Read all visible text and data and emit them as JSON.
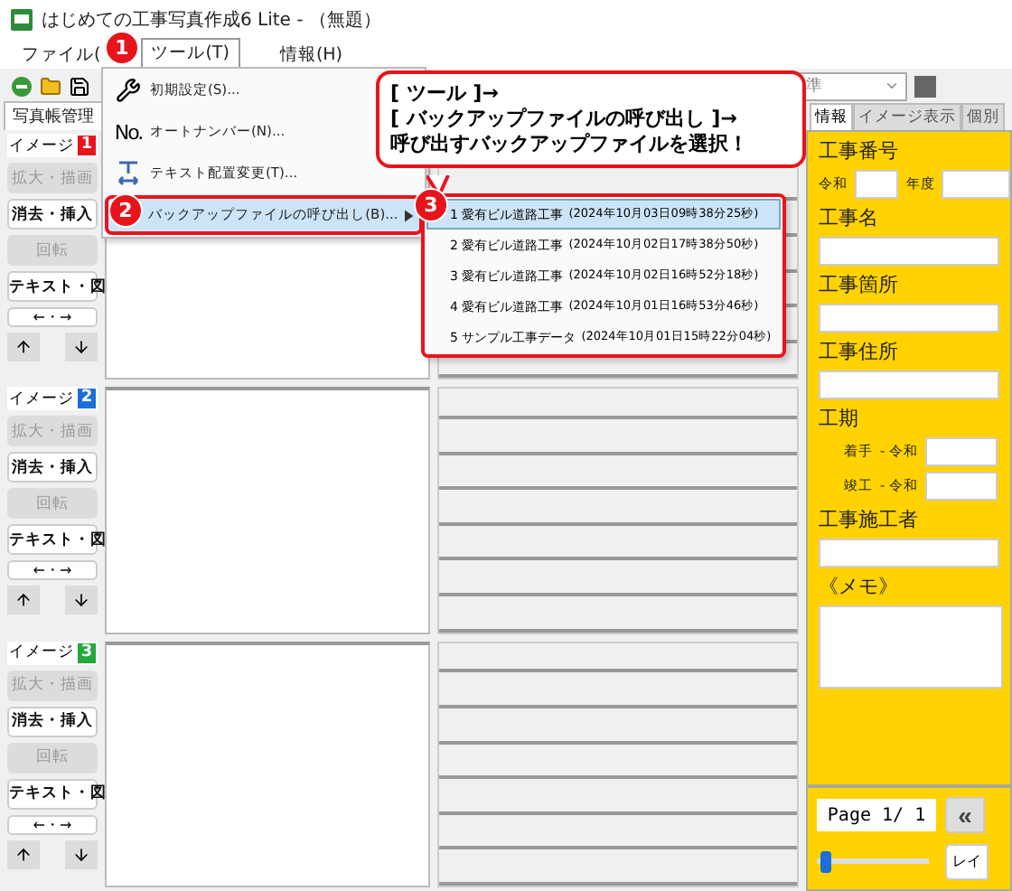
{
  "window": {
    "title": "はじめての工事写真作成6 Lite - （無題）"
  },
  "menu_bar": [
    {
      "label": "ファイル(",
      "selected": false
    },
    {
      "label": "ツール(T)",
      "selected": true
    },
    {
      "label": "情報(H)",
      "selected": false
    }
  ],
  "toolbar": {
    "style_select": "準"
  },
  "left_tabs": [
    {
      "label": "写真帳管理",
      "selected": true
    }
  ],
  "images": [
    {
      "label": "イメージ",
      "number": "1",
      "color": "#e8141c",
      "buttons": [
        {
          "label": "拡大・描画",
          "disabled": true
        },
        {
          "label": "消去・挿入",
          "disabled": false
        },
        {
          "label": "回転",
          "disabled": true
        },
        {
          "label": "テキスト・図",
          "disabled": false
        }
      ],
      "lr": "←・→"
    },
    {
      "label": "イメージ",
      "number": "2",
      "color": "#1a6fd8",
      "buttons": [
        {
          "label": "拡大・描画",
          "disabled": true
        },
        {
          "label": "消去・挿入",
          "disabled": false
        },
        {
          "label": "回転",
          "disabled": true
        },
        {
          "label": "テキスト・図",
          "disabled": false
        }
      ],
      "lr": "←・→"
    },
    {
      "label": "イメージ",
      "number": "3",
      "color": "#22a83a",
      "buttons": [
        {
          "label": "拡大・描画",
          "disabled": true
        },
        {
          "label": "消去・挿入",
          "disabled": false
        },
        {
          "label": "回転",
          "disabled": true
        },
        {
          "label": "テキスト・図",
          "disabled": false
        }
      ],
      "lr": "←・→"
    }
  ],
  "right_tabs": [
    {
      "label": "情報",
      "selected": true
    },
    {
      "label": "イメージ表示",
      "selected": false
    },
    {
      "label": "個別",
      "selected": false
    }
  ],
  "info": {
    "number_label": "工事番号",
    "era": "令和",
    "year_suffix": "年度",
    "name_label": "工事名",
    "place_label": "工事箇所",
    "address_label": "工事住所",
    "period_label": "工期",
    "start_label": "着手",
    "end_label": "竣工",
    "start_era": "- 令和",
    "end_era": "- 令和",
    "builder_label": "工事施工者",
    "memo_label": "《メモ》"
  },
  "pager": {
    "page": "Page 1/ 1",
    "first": "«",
    "layout": "レイ",
    "level": 0.03
  },
  "tool_menu": [
    {
      "label": "初期設定(S)...",
      "selected": false,
      "submenu": false
    },
    {
      "icon_text": "No.",
      "label": "オートナンバー(N)...",
      "selected": false,
      "submenu": false
    },
    {
      "label": "テキスト配置変更(T)...",
      "selected": false,
      "submenu": false
    },
    {
      "label": "バックアップファイルの呼び出し(B)...",
      "selected": true,
      "submenu": true
    }
  ],
  "backup_menu": [
    {
      "label": "1 愛有ビル道路工事",
      "time": "(2024年10月03日09時38分25秒)",
      "selected": true
    },
    {
      "label": "2 愛有ビル道路工事",
      "time": "(2024年10月02日17時38分50秒)",
      "selected": false
    },
    {
      "label": "3 愛有ビル道路工事",
      "time": "(2024年10月02日16時52分18秒)",
      "selected": false
    },
    {
      "label": "4 愛有ビル道路工事",
      "time": "(2024年10月01日16時53分46秒)",
      "selected": false
    },
    {
      "label": "5 サンプル工事データ",
      "time": "(2024年10月01日15時22分04秒)",
      "selected": false
    }
  ],
  "callout": {
    "lines": [
      "[ ツール ]→",
      "[ バックアップファイルの呼び出し ]→",
      "呼び出すバックアップファイルを選択！"
    ]
  },
  "steps": [
    "1",
    "2",
    "3"
  ]
}
